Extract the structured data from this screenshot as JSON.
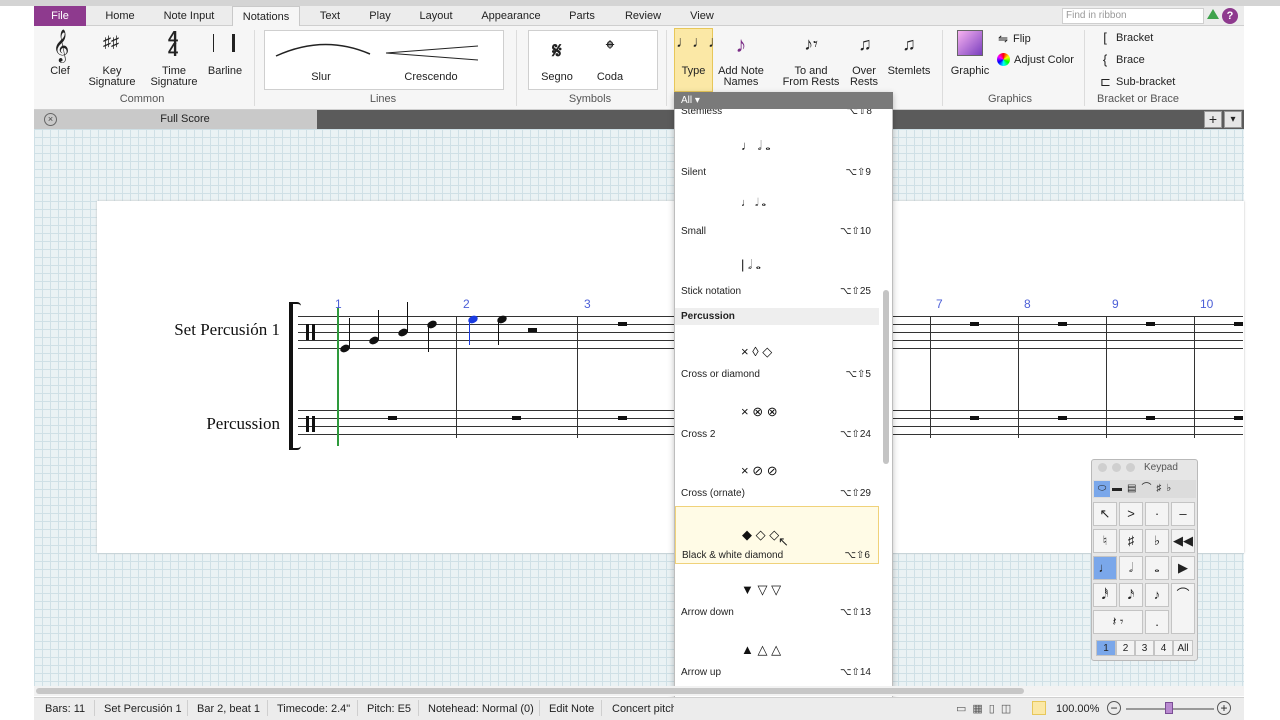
{
  "menubar": {
    "tabs": [
      "File",
      "Home",
      "Note Input",
      "Notations",
      "Text",
      "Play",
      "Layout",
      "Appearance",
      "Parts",
      "Review",
      "View"
    ],
    "find_placeholder": "Find in ribbon"
  },
  "ribbon": {
    "common": {
      "group": "Common",
      "clef": "Clef",
      "key": "Key Signature",
      "time": "Time Signature",
      "barline": "Barline"
    },
    "lines": {
      "group": "Lines",
      "slur": "Slur",
      "crescendo": "Crescendo"
    },
    "symbols": {
      "group": "Symbols",
      "segno": "Segno",
      "coda": "Coda"
    },
    "noteheads": {
      "type": "Type",
      "add_note_names": "Add Note Names"
    },
    "rests": {
      "to_and_from": "To and From Rests",
      "over": "Over Rests",
      "stemlets": "Stemlets"
    },
    "graphics": {
      "group": "Graphics",
      "graphic": "Graphic",
      "flip": "Flip",
      "adjust_color": "Adjust Color"
    },
    "bracket": {
      "group": "Bracket or Brace",
      "bracket": "Bracket",
      "brace": "Brace",
      "sub_bracket": "Sub-bracket"
    }
  },
  "score_tab": "Full Score",
  "score": {
    "instruments": [
      "Set Percusión 1",
      "Percussion"
    ],
    "bar_numbers": [
      "1",
      "2",
      "3",
      "7",
      "8",
      "9",
      "10"
    ]
  },
  "dropdown": {
    "filter": "All",
    "partial_top": "Stemless",
    "partial_top_key": "⌥⇧8",
    "section": "Percussion",
    "items": [
      {
        "name": "Silent",
        "key": "⌥⇧9"
      },
      {
        "name": "Small",
        "key": "⌥⇧10"
      },
      {
        "name": "Stick notation",
        "key": "⌥⇧25"
      },
      {
        "name": "Cross or diamond",
        "key": "⌥⇧5"
      },
      {
        "name": "Cross 2",
        "key": "⌥⇧24"
      },
      {
        "name": "Cross (ornate)",
        "key": "⌥⇧29"
      },
      {
        "name": "Black & white diamond",
        "key": "⌥⇧6"
      },
      {
        "name": "Arrow down",
        "key": "⌥⇧13"
      },
      {
        "name": "Arrow up",
        "key": "⌥⇧14"
      }
    ]
  },
  "keypad": {
    "title": "Keypad",
    "tabs": [
      "1",
      "2",
      "3",
      "4",
      "All"
    ]
  },
  "status": {
    "bars": "Bars: 11",
    "instrument": "Set Percusión 1",
    "position": "Bar 2, beat 1",
    "timecode": "Timecode: 2.4\"",
    "pitch": "Pitch: E5",
    "notehead": "Notehead: Normal (0)",
    "mode": "Edit Note",
    "concert": "Concert pitch",
    "zoom": "100.00%"
  },
  "colors": {
    "file_tab": "#8e3a8e",
    "bar_number": "#4c5fd7",
    "selection": "#f0d27a"
  }
}
